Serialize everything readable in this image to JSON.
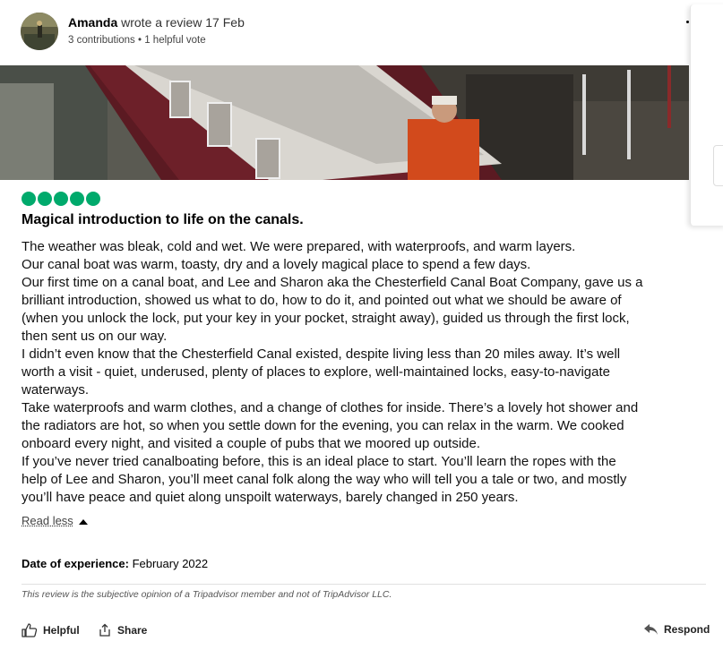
{
  "review": {
    "user_name": "Amanda",
    "action_text": "wrote a review 17 Feb",
    "meta": "3 contributions • 1 helpful vote",
    "rating_bubbles": 5,
    "rating_color": "#00aa6c",
    "title": "Magical introduction to life on the canals.",
    "body_lines": [
      "The weather was bleak, cold and wet. We were prepared, with waterproofs, and warm layers.",
      "Our canal boat was warm, toasty, dry and a lovely magical place to spend a few days.",
      "Our first time on a canal boat, and Lee and Sharon aka the Chesterfield Canal Boat Company, gave us a",
      "brilliant introduction, showed us what to do, how to do it, and pointed out what we should be aware of",
      "(when you unlock the lock, put your key in your pocket, straight away), guided us through the first lock,",
      "then sent us on our way.",
      "I didn’t even know that the Chesterfield Canal existed, despite living less than 20 miles away. It’s well",
      "worth a visit - quiet, underused, plenty of places to explore, well-maintained locks, easy-to-navigate",
      "waterways.",
      "Take waterproofs and warm clothes, and a change of clothes for inside. There’s a lovely hot shower and",
      "the radiators are hot, so when you settle down for the evening, you can relax in the warm. We cooked",
      "onboard every night, and visited a couple of pubs that we moored up outside.",
      "If you’ve never tried canalboating before, this is an ideal place to start. You’ll learn the ropes with the",
      "help of Lee and Sharon, you’ll meet canal folk along the way who will tell you a tale or two, and mostly",
      "you’ll have peace and quiet along unspoilt waterways, barely changed in 250 years."
    ],
    "read_less_label": "Read less",
    "date_of_experience_label": "Date of experience:",
    "date_of_experience_value": "February 2022",
    "disclaimer": "This review is the subjective opinion of a Tripadvisor member and not of TripAdvisor LLC."
  },
  "actions": {
    "helpful_label": "Helpful",
    "share_label": "Share",
    "respond_label": "Respond"
  },
  "icons": [
    "avatar",
    "review-photo",
    "thumbs-up-icon",
    "share-icon",
    "reply-arrow-icon",
    "caret-up-icon"
  ]
}
